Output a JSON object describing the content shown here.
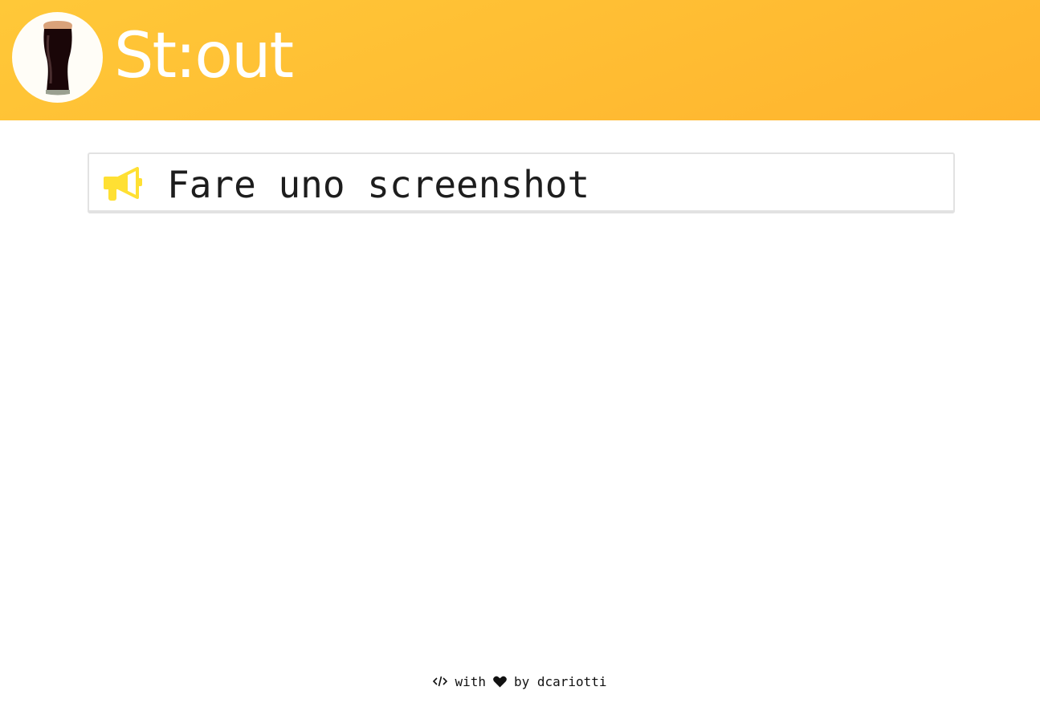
{
  "header": {
    "brand": "St:out",
    "background_color": "#ffbd33",
    "logo_icon": "stout-pint-glass-icon"
  },
  "announcement": {
    "icon": "megaphone-icon",
    "icon_color": "#ffe033",
    "title": "Fare uno screenshot"
  },
  "footer": {
    "code_icon": "code-icon",
    "with_text": "with",
    "heart_icon": "heart-icon",
    "by_text": "by dcariotti"
  }
}
